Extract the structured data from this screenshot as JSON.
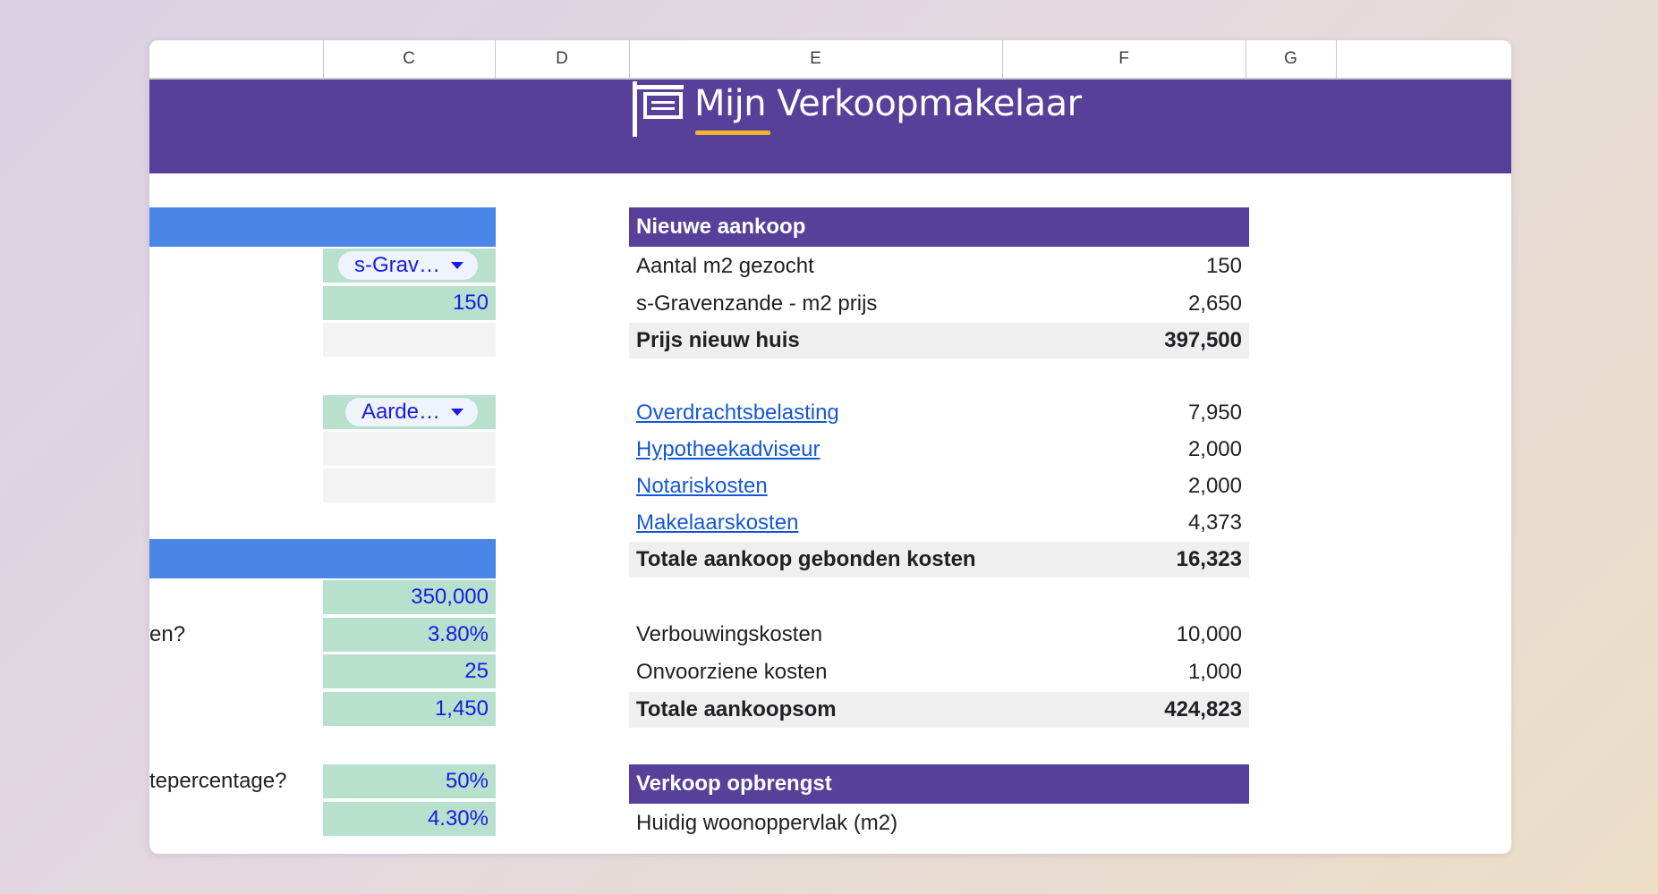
{
  "columns": [
    "C",
    "D",
    "E",
    "F",
    "G"
  ],
  "banner": {
    "logo_text": "Mijn Verkoopmakelaar"
  },
  "left": {
    "dropdown_location": "s-Grav…",
    "m2_value": "150",
    "dropdown_type": "Aarde…",
    "amount": "350,000",
    "interest_label_fragment": "en?",
    "interest_rate": "3.80%",
    "years": "25",
    "monthly": "1,450",
    "percentage_label_fragment": "­tepercentage?",
    "percentage": "50%",
    "rate2": "4.30%"
  },
  "panel": {
    "header_nieuwe": "Nieuwe aankoop",
    "rows": [
      {
        "label": "Aantal m2 gezocht",
        "value": "150"
      },
      {
        "label": "s-Gravenzande - m2 prijs",
        "value": "2,650"
      },
      {
        "label": "Prijs nieuw huis",
        "value": "397,500"
      },
      {
        "label": "Overdrachtsbelasting",
        "value": "7,950"
      },
      {
        "label": "Hypotheekadviseur",
        "value": "2,000"
      },
      {
        "label": "Notariskosten",
        "value": "2,000"
      },
      {
        "label": "Makelaarskosten",
        "value": "4,373"
      },
      {
        "label": "Totale aankoop gebonden kosten",
        "value": "16,323"
      },
      {
        "label": "Verbouwingskosten",
        "value": "10,000"
      },
      {
        "label": "Onvoorziene kosten",
        "value": "1,000"
      },
      {
        "label": "Totale aankoopsom",
        "value": "424,823"
      }
    ],
    "header_verkoop": "Verkoop opbrengst",
    "verkoop_rows": [
      {
        "label": "Huidig woonoppervlak (m2)",
        "value": ""
      }
    ]
  },
  "colors": {
    "banner": "#56409a",
    "section_blue": "#4a86e8",
    "input_green": "#b7e1cd",
    "accent_yellow": "#f3b331"
  }
}
